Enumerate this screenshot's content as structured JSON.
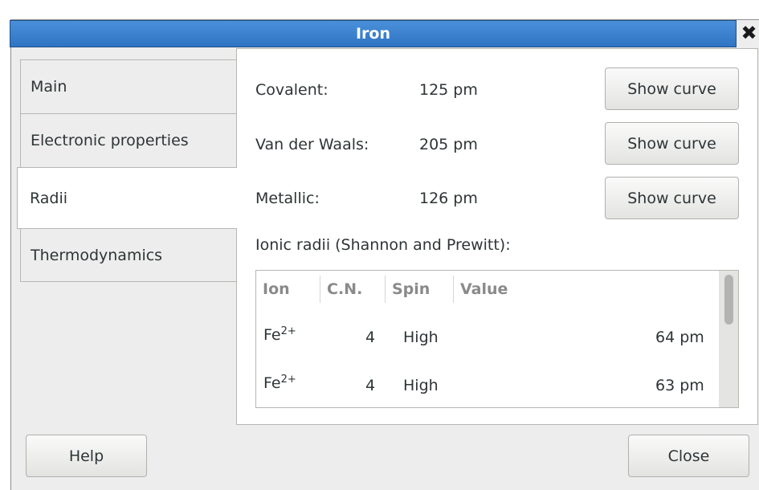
{
  "window": {
    "title": "Iron",
    "close_glyph": "✖"
  },
  "tabs": [
    {
      "label": "Main"
    },
    {
      "label": "Electronic properties"
    },
    {
      "label": "Radii"
    },
    {
      "label": "Thermodynamics"
    }
  ],
  "radii": {
    "covalent": {
      "label": "Covalent:",
      "value": "125 pm",
      "button": "Show curve"
    },
    "vdw": {
      "label": "Van der Waals:",
      "value": "205 pm",
      "button": "Show curve"
    },
    "metallic": {
      "label": "Metallic:",
      "value": "126 pm",
      "button": "Show curve"
    },
    "ionic_label": "Ionic radii (Shannon and Prewitt):"
  },
  "ionic_table": {
    "headers": [
      "Ion",
      "C.N.",
      "Spin",
      "Value"
    ],
    "rows": [
      {
        "ion": "Fe",
        "charge": "2+",
        "cn": "4",
        "spin": "High",
        "value": "64 pm"
      },
      {
        "ion": "Fe",
        "charge": "2+",
        "cn": "4",
        "spin": "High",
        "value": "63 pm"
      }
    ]
  },
  "footer": {
    "help_label": "Help",
    "close_label": "Close"
  }
}
